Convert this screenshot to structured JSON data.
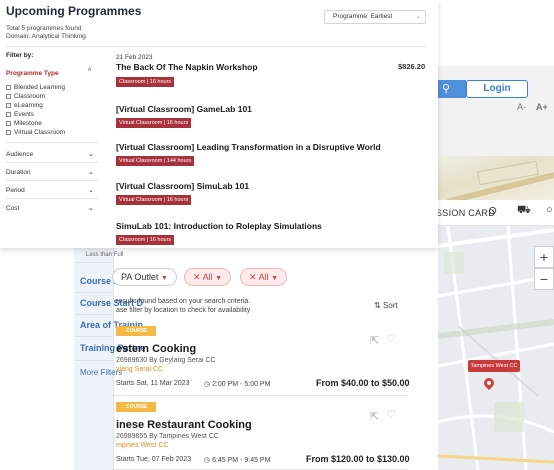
{
  "popup": {
    "title": "Upcoming Programmes",
    "count_text": "Total 5 programmes found",
    "domain_text": "Domain: Analytical Thinking",
    "sort_value": "Programme: Earliest",
    "filter_by": "Filter by:",
    "programme_type": {
      "label": "Programme Type",
      "options": [
        "Blended Learning",
        "Classroom",
        "eLearning",
        "Events",
        "Milestone",
        "Virtual Classroom"
      ]
    },
    "filter_sections": [
      "Audience",
      "Duration",
      "Period",
      "Cost"
    ],
    "programmes": [
      {
        "date": "21 Feb 2023",
        "title": "The Back Of The Napkin Workshop",
        "tag": "Classroom | 16 hours",
        "price": "$826.20"
      },
      {
        "title": "[Virtual Classroom] GameLab 101",
        "tag": "Virtual Classroom | 16 hours"
      },
      {
        "title": "[Virtual Classroom] Leading Transformation in a Disruptive World",
        "tag": "Virtual Classroom | 144 hours"
      },
      {
        "title": "[Virtual Classroom] SimuLab 101",
        "tag": "Virtual Classroom | 16 hours"
      },
      {
        "title": "SimuLab 101: Introduction to Roleplay Simulations",
        "tag": "Classroom | 16 hours"
      }
    ]
  },
  "background_site": {
    "header": {
      "login": "Login",
      "font_small": "A-",
      "font_large": "A+"
    },
    "nav": {
      "label": "SSION CARD"
    },
    "cut_text": "Less than Full",
    "left_filters": [
      "Course Fee",
      "Course Start D",
      "Area of Trainin",
      "Training Partne",
      "More Filters"
    ],
    "chips": {
      "outlet": "PA Outlet",
      "all1": "All",
      "all2": "All"
    },
    "results_line1": "results found based on your search criteria.",
    "results_line2": "ase filter by location to check for availability",
    "sort_label": "Sort",
    "cards": [
      {
        "badge": "COURSE",
        "title": "estern Cooking",
        "code": "26989630  By Geylang Serai CC",
        "location": "ylang Serai CC",
        "date": "Starts Sat, 11 Mar 2023",
        "time": "2:00 PM - 5:00 PM",
        "price": "From $40.00 to $50.00"
      },
      {
        "badge": "COURSE",
        "title": "inese Restaurant Cooking",
        "code": "26989855  By Tampines West CC",
        "location": "mpines West CC",
        "date": "Starts Tue, 07 Feb 2023",
        "time": "6:45 PM - 9:45 PM",
        "price": "From $120.00 to $130.00"
      }
    ],
    "map": {
      "marker_label": "Tampines West CC",
      "zoom_in": "+",
      "zoom_out": "−"
    }
  }
}
